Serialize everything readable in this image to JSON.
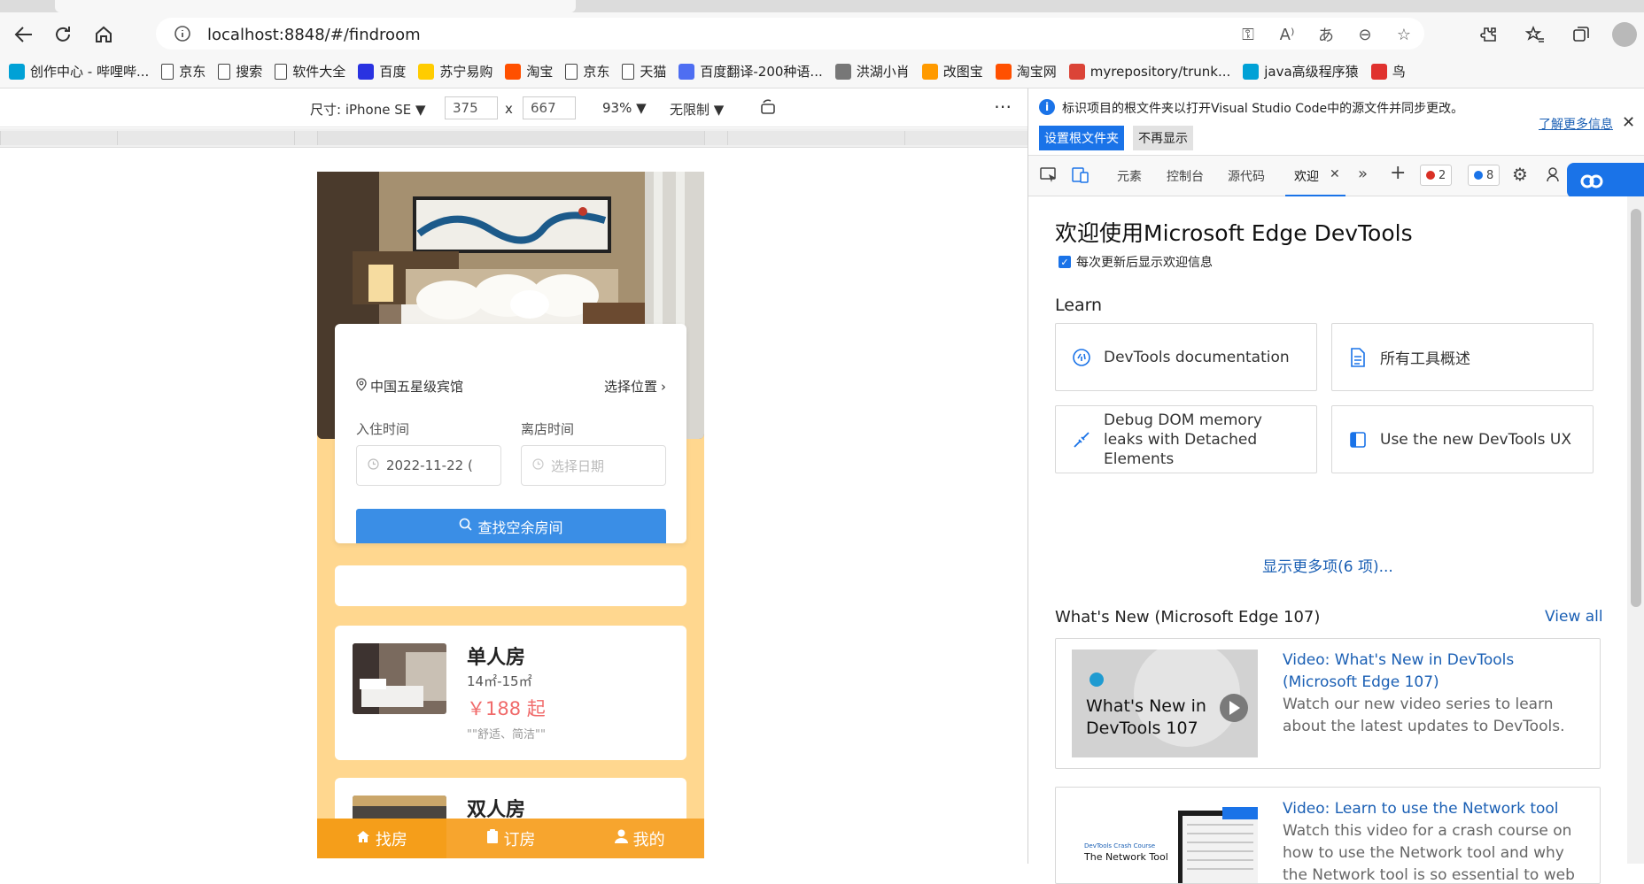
{
  "browser": {
    "url": "localhost:8848/#/findroom",
    "bookmarks": [
      {
        "label": "创作中心 - 哔哩哔...",
        "icon": "bilibili-icon",
        "color": "#00a1d6"
      },
      {
        "label": "京东",
        "icon": "page-icon"
      },
      {
        "label": "搜索",
        "icon": "page-icon"
      },
      {
        "label": "软件大全",
        "icon": "page-icon"
      },
      {
        "label": "百度",
        "icon": "baidu-icon",
        "color": "#2932e1"
      },
      {
        "label": "苏宁易购",
        "icon": "suning-icon",
        "color": "#ffcc00"
      },
      {
        "label": "淘宝",
        "icon": "taobao-icon",
        "color": "#ff5000"
      },
      {
        "label": "京东",
        "icon": "page-icon"
      },
      {
        "label": "天猫",
        "icon": "page-icon"
      },
      {
        "label": "百度翻译-200种语...",
        "icon": "translate-icon",
        "color": "#4e6ef2"
      },
      {
        "label": "洪湖小肖",
        "icon": "bird-icon",
        "color": "#777777"
      },
      {
        "label": "改图宝",
        "icon": "gaitubao-icon",
        "color": "#ff9a00"
      },
      {
        "label": "淘宝网",
        "icon": "taobao-icon",
        "color": "#ff5000"
      },
      {
        "label": "myrepository/trunk...",
        "icon": "chrome-icon",
        "color": "#db4437"
      },
      {
        "label": "java高级程序猿",
        "icon": "bilibili-icon",
        "color": "#00a1d6"
      },
      {
        "label": "鸟",
        "icon": "bird-red-icon",
        "color": "#e0322f"
      }
    ]
  },
  "device": {
    "size_label": "尺寸: iPhone SE",
    "width": "375",
    "times": "x",
    "height": "667",
    "zoom": "93%",
    "throttle": "无限制"
  },
  "app": {
    "hotel": "中国五星级宾馆",
    "pick_location": "选择位置",
    "checkin_label": "入住时间",
    "checkout_label": "离店时间",
    "checkin_value": "2022-11-22 (",
    "checkout_placeholder": "选择日期",
    "find_button": "查找空余房间",
    "rooms": [
      {
        "name": "单人房",
        "size": "14㎡-15㎡",
        "price": "￥188 起",
        "tag": "\"\"舒适、简洁\"\""
      },
      {
        "name": "双人房"
      }
    ],
    "tabs": [
      "找房",
      "订房",
      "我的"
    ]
  },
  "devtools": {
    "info_message": "标识项目的根文件夹以打开Visual Studio Code中的源文件并同步更改。",
    "learn_more": "了解更多信息",
    "set_root_button": "设置根文件夹",
    "dont_show_button": "不再显示",
    "tabs": [
      "元素",
      "控制台",
      "源代码",
      "欢迎"
    ],
    "errors": "2",
    "messages": "8",
    "welcome_title": "欢迎使用Microsoft Edge DevTools",
    "show_welcome": "每次更新后显示欢迎信息",
    "learn_title": "Learn",
    "cards": [
      {
        "label": "DevTools documentation",
        "icon": "docs-icon"
      },
      {
        "label": "所有工具概述",
        "icon": "file-icon"
      },
      {
        "label": "Debug DOM memory leaks with Detached Elements",
        "icon": "debug-icon"
      },
      {
        "label": "Use the new DevTools UX",
        "icon": "sidebar-icon"
      }
    ],
    "show_more": "显示更多项(6 项)...",
    "whats_new_title": "What's New (Microsoft Edge 107)",
    "view_all": "View all",
    "news": [
      {
        "title": "Video: What's New in DevTools (Microsoft Edge 107)",
        "desc": "Watch our new video series to learn about the latest updates to DevTools.",
        "thumb_text": "What's New in DevTools 107"
      },
      {
        "title": "Video: Learn to use the Network tool",
        "desc": "Watch this video for a crash course on how to use the Network tool and why the Network tool is so essential to web",
        "thumb_small": "DevTools Crash Course",
        "thumb_text": "The Network Tool"
      }
    ]
  },
  "colors": {
    "accent": "#1a73e8",
    "tabbar": "#f7a52e",
    "page_bg": "#ffd78f",
    "price": "#f06a6a",
    "find_button": "#3a8ee6"
  }
}
